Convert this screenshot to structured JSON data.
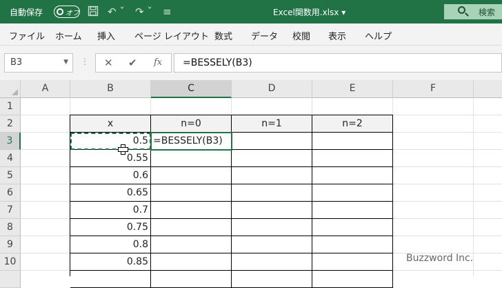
{
  "titlebar": {
    "autosave_label": "自動保存",
    "autosave_state": "オフ",
    "filename": "Excel関数用.xlsx ▾",
    "search_label": "検索",
    "icons": [
      "save-icon",
      "undo-icon",
      "redo-icon",
      "customize-qat-icon"
    ],
    "undo_glyph": "↶ ˇ",
    "redo_glyph": "↷ ˇ",
    "qat_glyph": "≡"
  },
  "ribbon": {
    "tabs": [
      "ファイル",
      "ホーム",
      "挿入",
      "ページ レイアウト",
      "数式",
      "データ",
      "校閲",
      "表示",
      "ヘルプ"
    ]
  },
  "formula_bar": {
    "name_box": "B3",
    "cancel_glyph": "✕",
    "enter_glyph": "✔",
    "fx_glyph": "fx",
    "formula": "=BESSELY(B3)"
  },
  "sheet": {
    "columns": [
      "A",
      "B",
      "C",
      "D",
      "E",
      "F"
    ],
    "rows": [
      "1",
      "2",
      "3",
      "4",
      "5",
      "6",
      "7",
      "8",
      "9",
      "10"
    ],
    "selected_column": "C",
    "selected_row": "3",
    "table_headers": [
      "x",
      "n=0",
      "n=1",
      "n=2"
    ],
    "x_values": [
      "0.5",
      "0.55",
      "0.6",
      "0.65",
      "0.7",
      "0.75",
      "0.8",
      "0.85"
    ],
    "editing_cell_text": "=BESSELY(B3)"
  },
  "watermark": "Buzzword Inc.",
  "colors": {
    "accent": "#217346",
    "search_bg": "#a8d3b9"
  }
}
